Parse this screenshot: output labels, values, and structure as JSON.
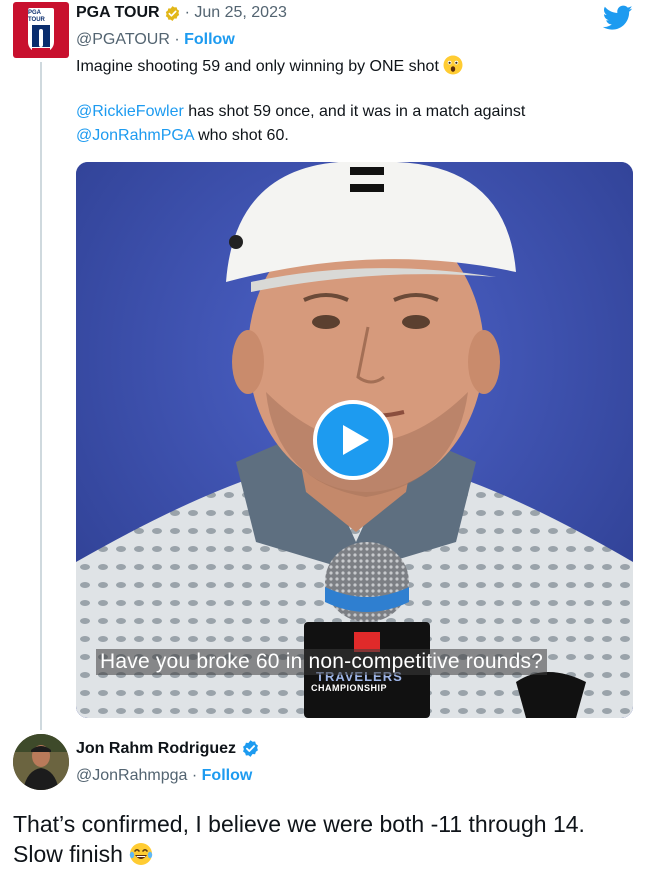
{
  "tweet": {
    "author_name": "PGA TOUR",
    "avatar_text": "PGA TOUR",
    "date": "· Jun 25, 2023",
    "handle": "@PGATOUR",
    "separator": " · ",
    "follow_label": "Follow",
    "text_line1": "Imagine shooting 59 and only winning by ONE shot",
    "line2_mention": "@RickieFowler",
    "line2_rest": " has shot 59 once, and it was in a match against",
    "line3_mention": "@JonRahmPGA",
    "line3_rest": " who shot 60.",
    "emoji_icon": "astonished-face-emoji",
    "media": {
      "caption": "Have you broke 60 in non-competitive rounds?",
      "sponsor_top": "TRAVELERS",
      "sponsor_bottom": "CHAMPIONSHIP"
    }
  },
  "reply": {
    "author_name": "Jon Rahm Rodriguez",
    "handle": "@JonRahmpga",
    "separator": " · ",
    "follow_label": "Follow",
    "text_line1": "That’s confirmed, I believe we were both -11 through 14.",
    "text_line2": "Slow finish",
    "emoji_icon": "tears-of-joy-emoji"
  },
  "colors": {
    "accent": "#1d9bf0",
    "text": "#0f1419",
    "muted": "#536471",
    "verified_gold": "#e2b719"
  }
}
